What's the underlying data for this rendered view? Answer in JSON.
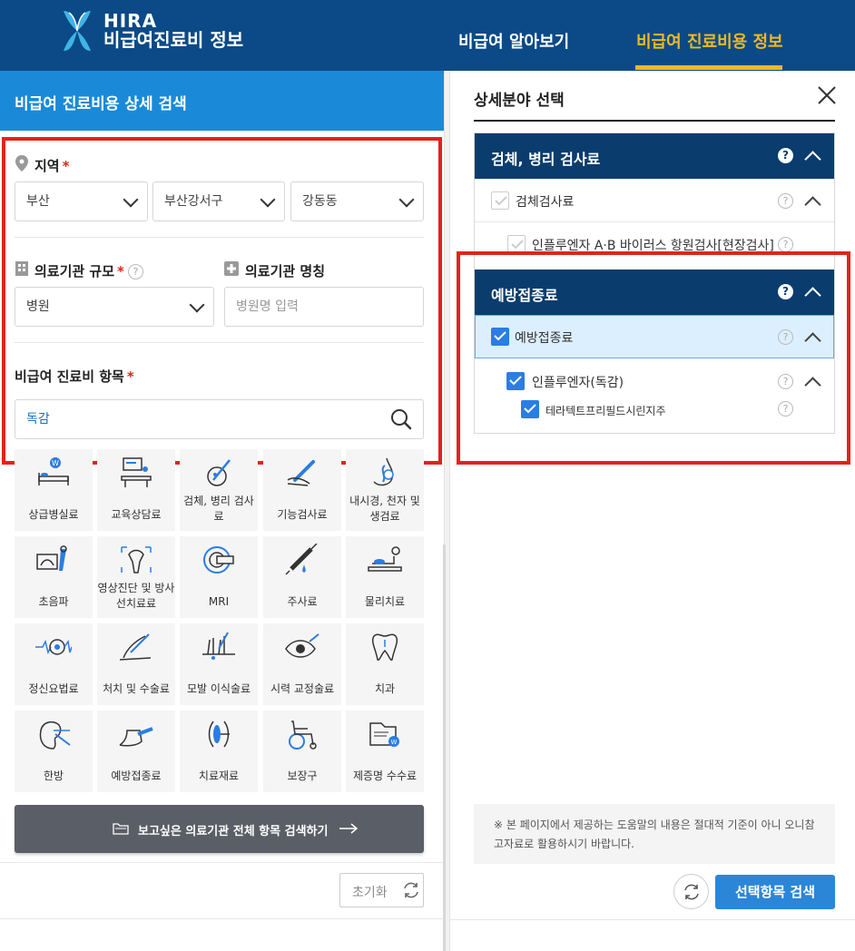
{
  "header": {
    "logo_en": "HIRA",
    "logo_ko": "비급여진료비 정보",
    "nav": [
      {
        "label": "비급여 알아보기"
      },
      {
        "label": "비급여 진료비용 정보"
      }
    ],
    "active_index": 1,
    "colors": {
      "bg": "#0b4a87",
      "active": "#f2b824"
    }
  },
  "left": {
    "title": "비급여 진료비용 상세 검색",
    "region": {
      "label": "지역",
      "required": "*",
      "selects": [
        "부산",
        "부산강서구",
        "강동동"
      ]
    },
    "scale": {
      "label": "의료기관 규모",
      "required": "*",
      "help": "?",
      "value": "병원"
    },
    "name": {
      "label": "의료기관 명칭",
      "placeholder": "병원명 입력"
    },
    "item": {
      "label": "비급여 진료비 항목",
      "required": "*",
      "value": "독감"
    },
    "categories": [
      {
        "label": "상급병실료",
        "icon": "hospital-bed-icon"
      },
      {
        "label": "교육상담료",
        "icon": "counseling-icon"
      },
      {
        "label": "검체, 병리 검사료",
        "icon": "specimen-test-icon"
      },
      {
        "label": "기능검사료",
        "icon": "thermometer-icon"
      },
      {
        "label": "내시경, 천자 및 생검료",
        "icon": "endoscope-icon"
      },
      {
        "label": "초음파",
        "icon": "ultrasound-icon"
      },
      {
        "label": "영상진단 및 방사선치료료",
        "icon": "radiology-icon"
      },
      {
        "label": "MRI",
        "icon": "mri-icon"
      },
      {
        "label": "주사료",
        "icon": "syringe-icon"
      },
      {
        "label": "물리치료",
        "icon": "physical-therapy-icon"
      },
      {
        "label": "정신요법료",
        "icon": "brainwave-icon"
      },
      {
        "label": "처치 및 수술료",
        "icon": "surgery-icon"
      },
      {
        "label": "모발 이식술료",
        "icon": "hair-transplant-icon"
      },
      {
        "label": "시력 교정술료",
        "icon": "eye-icon"
      },
      {
        "label": "치과",
        "icon": "tooth-icon"
      },
      {
        "label": "한방",
        "icon": "acupuncture-icon"
      },
      {
        "label": "예방접종료",
        "icon": "vaccine-icon"
      },
      {
        "label": "치료재료",
        "icon": "lens-material-icon"
      },
      {
        "label": "보장구",
        "icon": "wheelchair-icon"
      },
      {
        "label": "제증명 수수료",
        "icon": "certificate-icon"
      }
    ],
    "all_search_label": "보고싶은 의료기관 전체 항목 검색하기",
    "reset_label": "초기화"
  },
  "right": {
    "title": "상세분야 선택",
    "groups": [
      {
        "title": "검체, 병리 검사료",
        "help": "?",
        "rows": [
          {
            "label": "검체검사료",
            "checked": false
          },
          {
            "label": "인플루엔자 A·B 바이러스 항원검사[현장검사]",
            "checked": false
          }
        ]
      },
      {
        "title": "예방접종료",
        "help": "?",
        "rows": [
          {
            "label": "예방접종료",
            "checked": true
          },
          {
            "label": "인플루엔자(독감)",
            "checked": true
          },
          {
            "label": "테라텍트프리필드시린지주",
            "checked": true
          }
        ]
      }
    ],
    "notice": "※ 본 페이지에서 제공하는 도움말의 내용은 절대적 기준이 아니 오니참고자료로 활용하시기 바랍니다.",
    "submit_label": "선택항목 검색"
  }
}
